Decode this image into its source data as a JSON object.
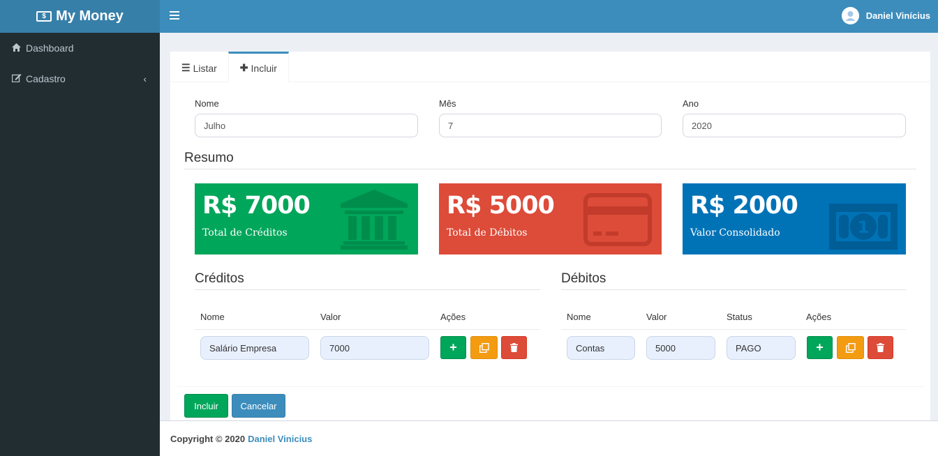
{
  "app": {
    "title": "My Money",
    "logo_icon": "money-bill-icon"
  },
  "sidebar": {
    "items": [
      {
        "label": "Dashboard",
        "icon": "home-icon"
      },
      {
        "label": "Cadastro",
        "icon": "edit-icon",
        "chevron": "chevron-left-icon"
      }
    ]
  },
  "topbar": {
    "menu_icon": "hamburger-icon",
    "user_name": "Daniel Vinícius"
  },
  "tabs": [
    {
      "label": "Listar",
      "icon": "list-icon"
    },
    {
      "label": "Incluir",
      "icon": "plus-icon",
      "active": true
    }
  ],
  "form": {
    "nome": {
      "label": "Nome",
      "value": "Julho"
    },
    "mes": {
      "label": "Mês",
      "value": "7"
    },
    "ano": {
      "label": "Ano",
      "value": "2020"
    }
  },
  "resumo": {
    "title": "Resumo",
    "cards": [
      {
        "amount": "R$ 7000",
        "label": "Total de Créditos",
        "color": "#00a65a",
        "icon": "bank-icon"
      },
      {
        "amount": "R$ 5000",
        "label": "Total de Débitos",
        "color": "#dd4b39",
        "icon": "credit-card-icon"
      },
      {
        "amount": "R$ 2000",
        "label": "Valor Consolidado",
        "color": "#0073b7",
        "icon": "money-icon"
      }
    ]
  },
  "creditos": {
    "title": "Créditos",
    "headers": [
      "Nome",
      "Valor",
      "Ações"
    ],
    "rows": [
      {
        "nome": "Salário Empresa",
        "valor": "7000"
      }
    ]
  },
  "debitos": {
    "title": "Débitos",
    "headers": [
      "Nome",
      "Valor",
      "Status",
      "Ações"
    ],
    "rows": [
      {
        "nome": "Contas",
        "valor": "5000",
        "status": "PAGO"
      }
    ]
  },
  "actions": {
    "incluir": "Incluir",
    "cancelar": "Cancelar"
  },
  "footer": {
    "copyright": "Copyright © 2020",
    "author": "Daniel Vinicius"
  }
}
